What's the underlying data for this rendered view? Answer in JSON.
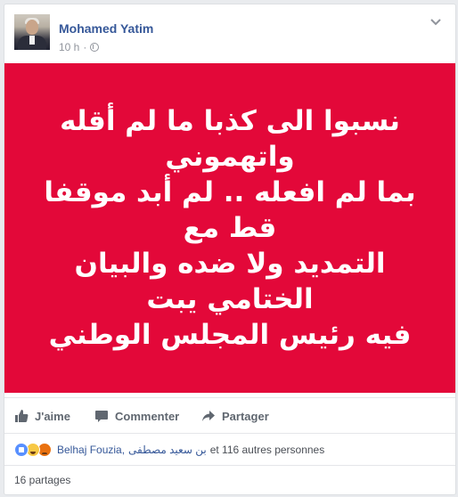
{
  "post": {
    "author": "Mohamed Yatim",
    "time": "10 h",
    "meta_sep": "·",
    "privacy_icon": "globe-icon",
    "menu_icon": "chevron-down-icon",
    "image": {
      "background": "#e30839",
      "text_lines": [
        "نسبوا الى كذبا ما لم أقله واتهموني",
        "بما لم افعله .. لم أبد موقفا قط مع",
        "التمديد ولا ضده والبيان الختامي يبت",
        "فيه رئيس المجلس الوطني"
      ]
    },
    "actions": {
      "like_label": "J'aime",
      "comment_label": "Commenter",
      "share_label": "Partager"
    },
    "reactions": {
      "icons": [
        "like-reaction",
        "haha-reaction",
        "angry-reaction"
      ],
      "person1": "Belhaj Fouzia,",
      "person2": "بن سعيد مصطفى",
      "rest": "et 116 autres personnes"
    },
    "shares": "16 partages"
  },
  "colors": {
    "link": "#365899",
    "accent_red": "#e30839",
    "muted": "#90949c"
  }
}
